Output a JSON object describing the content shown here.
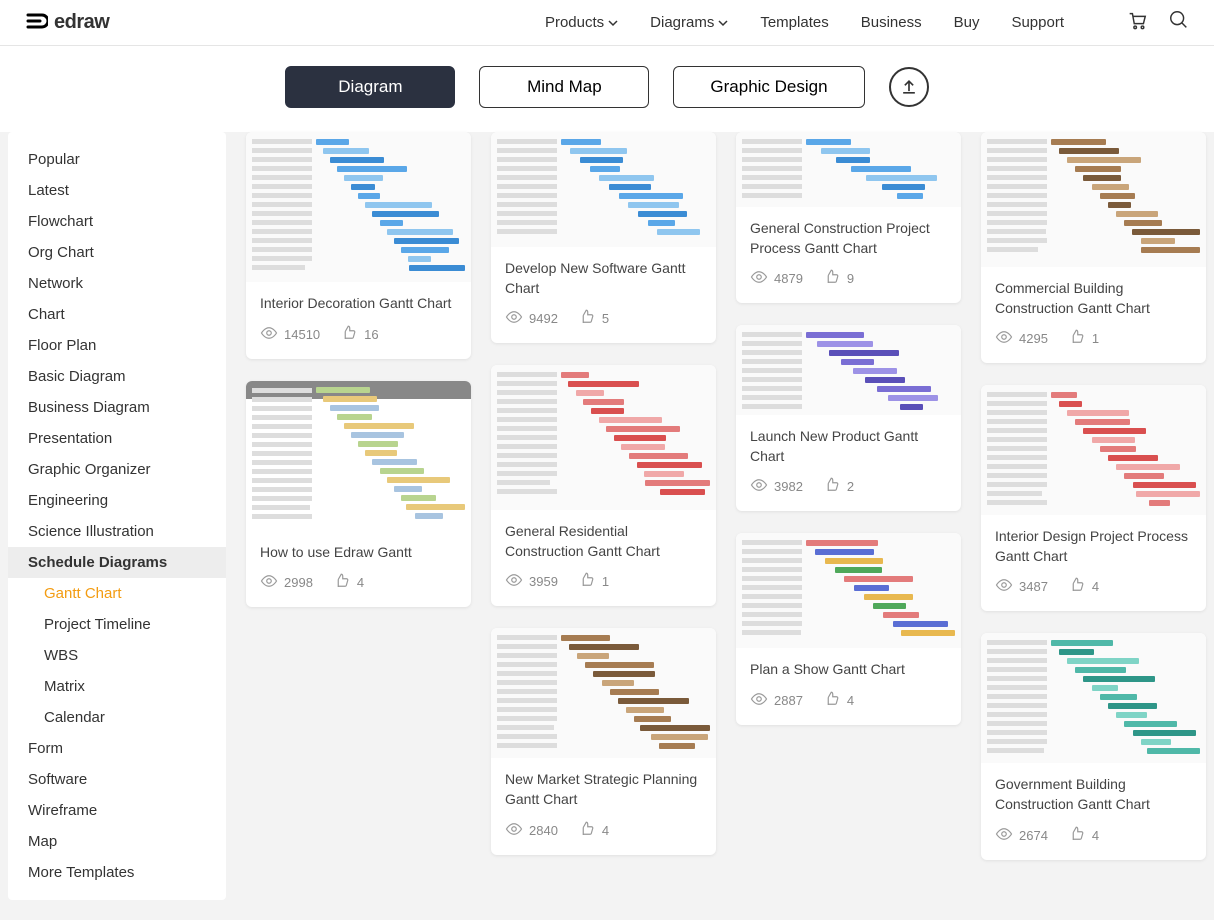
{
  "brand": {
    "name": "edraw"
  },
  "nav": {
    "products": "Products",
    "diagrams": "Diagrams",
    "templates": "Templates",
    "business": "Business",
    "buy": "Buy",
    "support": "Support"
  },
  "tabs": {
    "diagram": "Diagram",
    "mindmap": "Mind Map",
    "graphic": "Graphic Design"
  },
  "sidebar": {
    "categories": [
      "Popular",
      "Latest",
      "Flowchart",
      "Org Chart",
      "Network",
      "Chart",
      "Floor Plan",
      "Basic Diagram",
      "Business Diagram",
      "Presentation",
      "Graphic Organizer",
      "Engineering",
      "Science Illustration",
      "Schedule Diagrams",
      "Form",
      "Software",
      "Wireframe",
      "Map",
      "More Templates"
    ],
    "selected_index": 13,
    "subcategories": [
      "Gantt Chart",
      "Project Timeline",
      "WBS",
      "Matrix",
      "Calendar"
    ],
    "active_sub_index": 0
  },
  "templates": {
    "col1": [
      {
        "title": "Interior Decoration Gantt Chart",
        "views": "14510",
        "likes": "16",
        "thumb_h": 150,
        "style": "blue"
      },
      {
        "title": "How to use Edraw Gantt",
        "views": "2998",
        "likes": "4",
        "thumb_h": 150,
        "style": "doc"
      }
    ],
    "col2": [
      {
        "title": "Develop New Software Gantt Chart",
        "views": "9492",
        "likes": "5",
        "thumb_h": 115,
        "style": "blue"
      },
      {
        "title": "General Residential Construction Gantt Chart",
        "views": "3959",
        "likes": "1",
        "thumb_h": 145,
        "style": "red"
      },
      {
        "title": "New Market Strategic Planning Gantt Chart",
        "views": "2840",
        "likes": "4",
        "thumb_h": 130,
        "style": "brown"
      }
    ],
    "col3": [
      {
        "title": "General Construction Project Process Gantt Chart",
        "views": "4879",
        "likes": "9",
        "thumb_h": 75,
        "style": "blue"
      },
      {
        "title": "Launch New Product Gantt Chart",
        "views": "3982",
        "likes": "2",
        "thumb_h": 90,
        "style": "purple"
      },
      {
        "title": "Plan a Show Gantt Chart",
        "views": "2887",
        "likes": "4",
        "thumb_h": 115,
        "style": "mix"
      }
    ],
    "col4": [
      {
        "title": "Commercial Building Construction Gantt Chart",
        "views": "4295",
        "likes": "1",
        "thumb_h": 135,
        "style": "brown"
      },
      {
        "title": "Interior Design Project Process Gantt Chart",
        "views": "3487",
        "likes": "4",
        "thumb_h": 130,
        "style": "red"
      },
      {
        "title": "Government Building Construction Gantt Chart",
        "views": "2674",
        "likes": "4",
        "thumb_h": 130,
        "style": "teal"
      }
    ]
  }
}
